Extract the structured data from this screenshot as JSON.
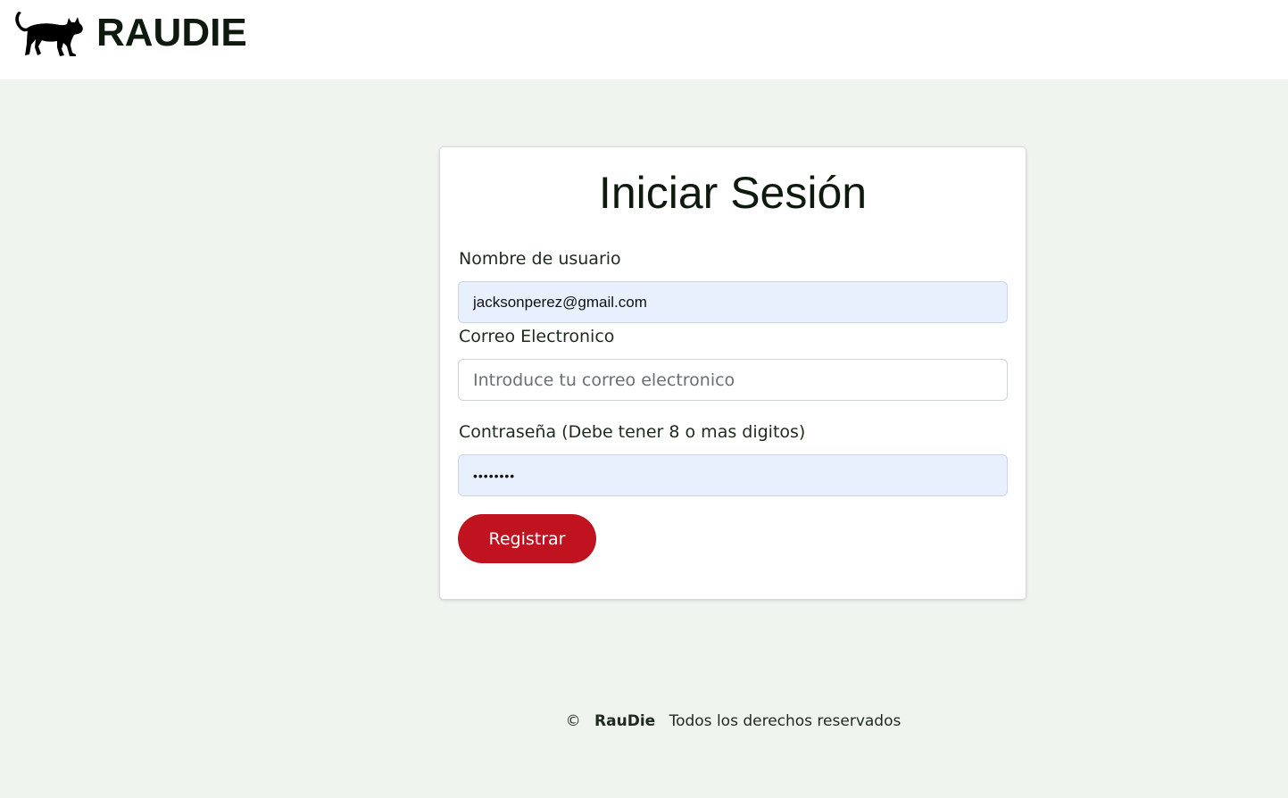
{
  "header": {
    "brand_name": "RAUDIE",
    "logo_icon": "black-cat-icon"
  },
  "form": {
    "title": "Iniciar Sesión",
    "username": {
      "label": "Nombre de usuario",
      "value": "jacksonperez@gmail.com"
    },
    "email": {
      "label": "Correo Electronico",
      "placeholder": "Introduce tu correo electronico",
      "value": ""
    },
    "password": {
      "label": "Contraseña (Debe tener 8 o mas digitos)",
      "value": "••••••••"
    },
    "submit_label": "Registrar"
  },
  "footer": {
    "copyright_symbol": "©",
    "brand": "RauDie",
    "rights_text": "Todos los derechos reservados"
  },
  "colors": {
    "page_background": "#f0f4ef",
    "button_background": "#c1121f",
    "autofill_background": "#e8f0fe",
    "text_dark": "#0f1a0e"
  }
}
